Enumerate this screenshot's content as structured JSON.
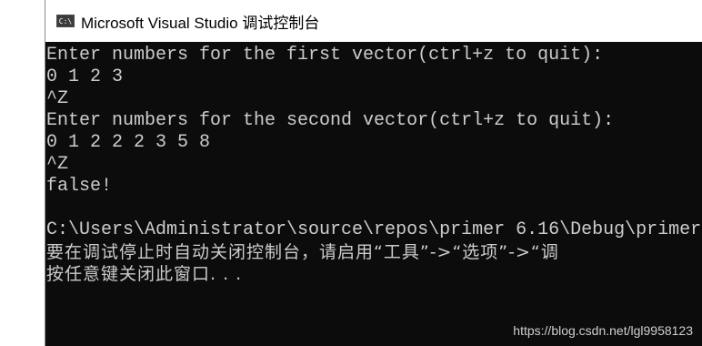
{
  "window": {
    "icon_text": "C:\\",
    "title": "Microsoft Visual Studio 调试控制台"
  },
  "console": {
    "lines": [
      "Enter numbers for the first vector(ctrl+z to quit):",
      "0 1 2 3",
      "^Z",
      "Enter numbers for the second vector(ctrl+z to quit):",
      "0 1 2 2 2 3 5 8",
      "^Z",
      "false!",
      "",
      "C:\\Users\\Administrator\\source\\repos\\primer 6.16\\Debug\\primer",
      "要在调试停止时自动关闭控制台，请启用“工具”->“选项”->“调",
      "按任意键关闭此窗口. . ."
    ]
  },
  "watermark": "https://blog.csdn.net/lgl9958123"
}
